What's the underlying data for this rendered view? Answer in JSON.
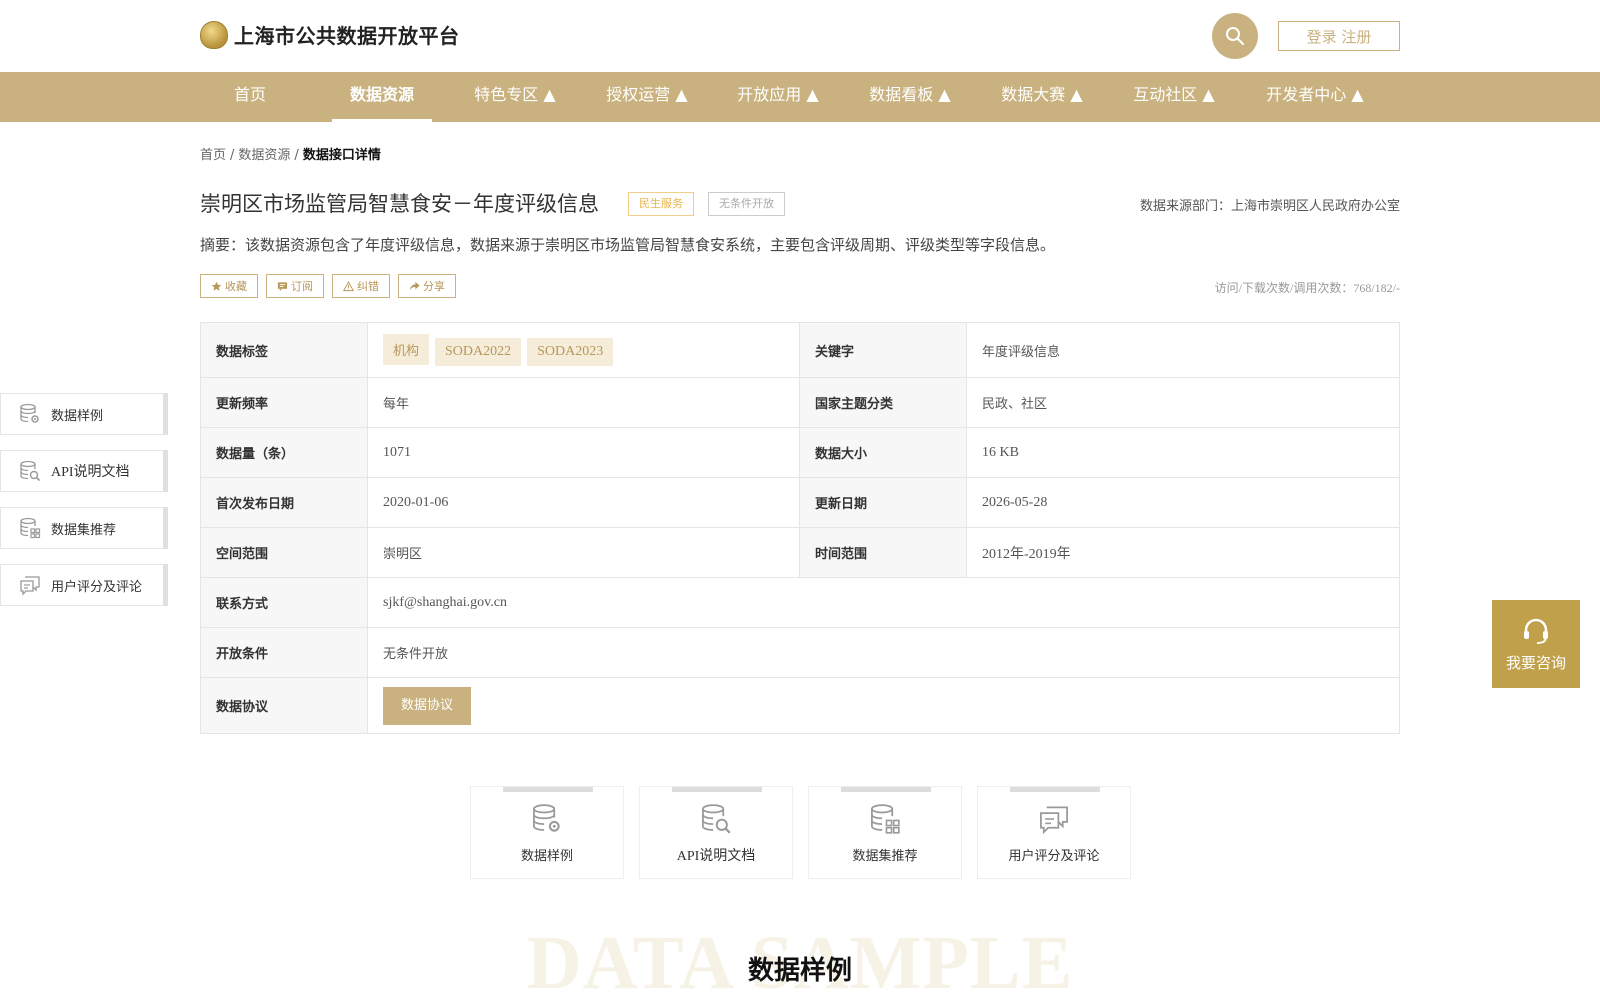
{
  "header": {
    "site_title": "上海市公共数据开放平台",
    "login_label": "登录 注册",
    "search_icon": "search-icon",
    "accent_color": "#c9b27f"
  },
  "nav": {
    "items": [
      {
        "label": "首页"
      },
      {
        "label": "数据资源"
      },
      {
        "label": "特色专区 ▲"
      },
      {
        "label": "授权运营 ▲"
      },
      {
        "label": "开放应用 ▲"
      },
      {
        "label": "数据看板 ▲"
      },
      {
        "label": "数据大赛 ▲"
      },
      {
        "label": "互动社区 ▲"
      },
      {
        "label": "开发者中心 ▲"
      }
    ],
    "active": "数据资源"
  },
  "breadcrumb": {
    "home": "首页",
    "sep": "/",
    "resources": "数据资源",
    "current": "数据接口详情"
  },
  "detail": {
    "title": "崇明区市场监管局智慧食安－年度评级信息",
    "tag_category": "民生服务",
    "tag_open": "无条件开放",
    "source_dept": "数据来源部门：上海市崇明区人民政府办公室",
    "summary": "摘要：该数据资源包含了年度评级信息，数据来源于崇明区市场监管局智慧食安系统，主要包含评级周期、评级类型等字段信息。",
    "actions": {
      "favorite": "收藏",
      "subscribe": "订阅",
      "report": "纠错",
      "share": "分享"
    },
    "stats": "访问/下载次数/调用次数：768/182/-"
  },
  "table": {
    "label_tags": "数据标签",
    "tags": [
      "机构",
      "SODA2022",
      "SODA2023"
    ],
    "label_keywords": "关键字",
    "keywords": "年度评级信息",
    "label_frequency": "更新频率",
    "frequency": "每年",
    "label_theme": "国家主题分类",
    "theme": "民政、社区",
    "label_count": "数据量（条）",
    "count": "1071",
    "label_size": "数据大小",
    "size": "16 KB",
    "label_first_pub": "首次发布日期",
    "first_pub": "2020-01-06",
    "label_updated": "更新日期",
    "updated": "2026-05-28",
    "label_space": "空间范围",
    "space": "崇明区",
    "label_time": "时间范围",
    "time": "2012年-2019年",
    "label_contact": "联系方式",
    "contact": "sjkf@shanghai.gov.cn",
    "label_condition": "开放条件",
    "condition": "无条件开放",
    "label_agreement": "数据协议",
    "agreement_button": "数据协议"
  },
  "side_menu": [
    {
      "label": "数据样例",
      "icon": "database-gear-icon"
    },
    {
      "label": "API说明文档",
      "icon": "database-search-icon"
    },
    {
      "label": "数据集推荐",
      "icon": "database-grid-icon"
    },
    {
      "label": "用户评分及评论",
      "icon": "comments-icon"
    }
  ],
  "consult": {
    "label": "我要咨询",
    "icon": "headset-icon"
  },
  "cards": [
    {
      "label": "数据样例",
      "icon": "database-gear-icon"
    },
    {
      "label": "API说明文档",
      "icon": "database-search-icon"
    },
    {
      "label": "数据集推荐",
      "icon": "database-grid-icon"
    },
    {
      "label": "用户评分及评论",
      "icon": "comments-icon"
    }
  ],
  "section": {
    "watermark": "DATA SAMPLE",
    "title": "数据样例"
  }
}
